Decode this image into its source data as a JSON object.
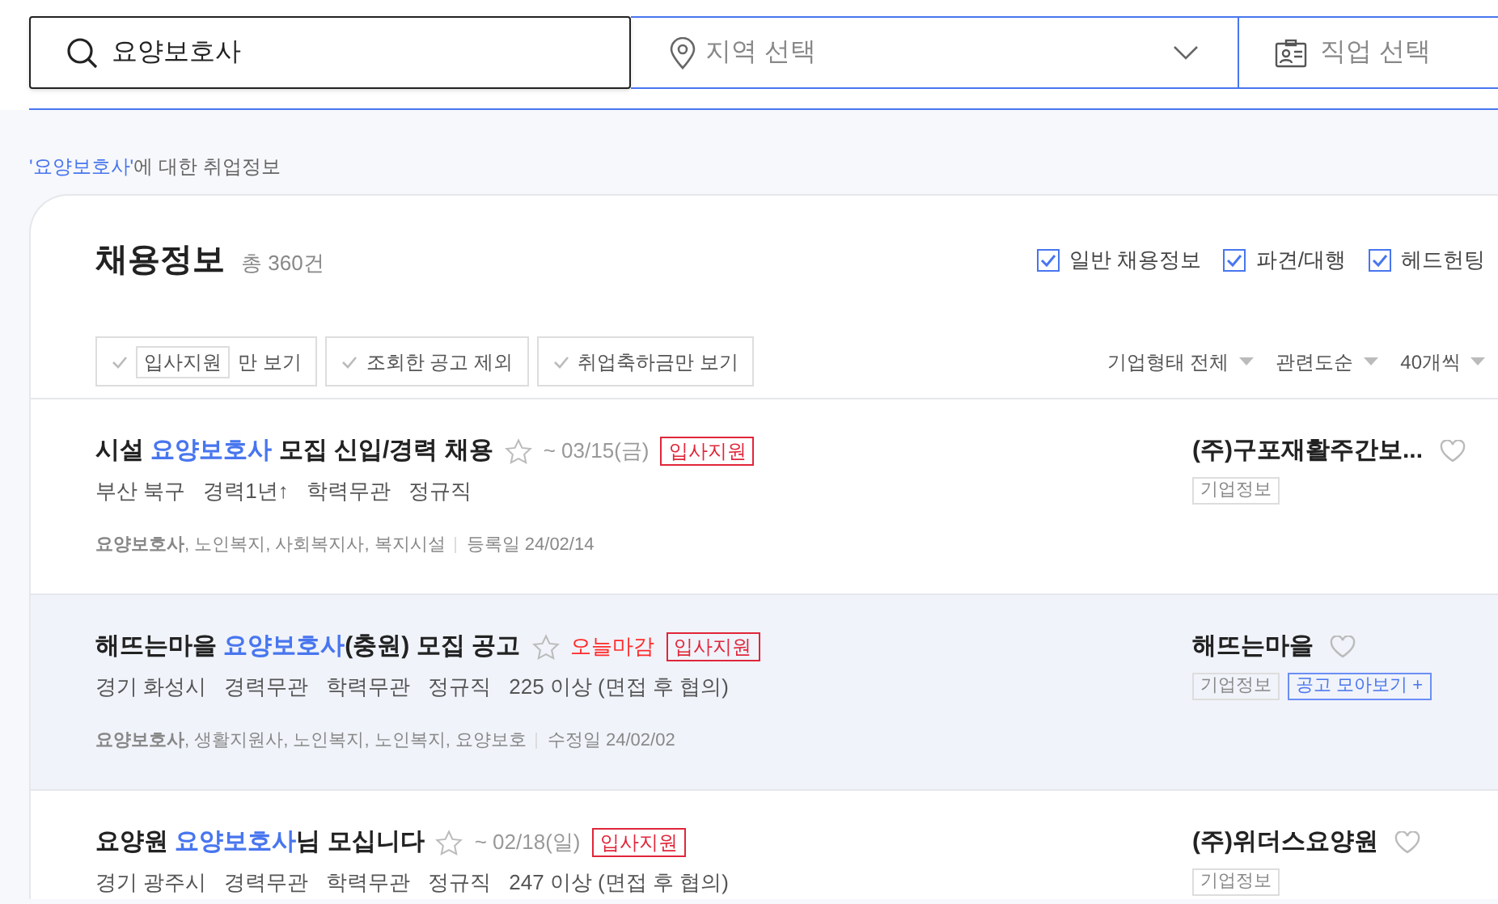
{
  "search": {
    "value": "요양보호사"
  },
  "region": {
    "placeholder": "지역 선택"
  },
  "job": {
    "placeholder": "직업 선택"
  },
  "result_caption": {
    "keyword": "'요양보호사'",
    "text": "에 대한 취업정보"
  },
  "header": {
    "title": "채용정보",
    "count": "총 360건"
  },
  "categories": [
    {
      "label": "일반 채용정보",
      "checked": true
    },
    {
      "label": "파견/대행",
      "checked": true
    },
    {
      "label": "헤드헌팅",
      "checked": true
    }
  ],
  "filters": [
    {
      "badge": "입사지원",
      "label": "만 보기",
      "checked": false
    },
    {
      "label": "조회한 공고 제외",
      "checked": false
    },
    {
      "label": "취업축하금만 보기",
      "checked": false
    }
  ],
  "sorts": [
    "기업형태 전체",
    "관련도순",
    "40개씩"
  ],
  "jobs": [
    {
      "title": {
        "prefix": "시설 ",
        "keyword": "요양보호사",
        "suffix": " 모집 신입/경력 채용"
      },
      "deadline": "~ 03/15(금)",
      "urgent": false,
      "apply": "입사지원",
      "info": [
        "부산 북구",
        "경력1년↑",
        "학력무관",
        "정규직"
      ],
      "keywords": "**요양보호사**, 노인복지, 사회복지사, 복지시설",
      "date": "등록일 24/02/14",
      "company": "(주)구포재활주간보...",
      "tags": [
        {
          "kind": "info",
          "label": "기업정보"
        }
      ],
      "hovered": false
    },
    {
      "title": {
        "prefix": "해뜨는마을 ",
        "keyword": "요양보호사",
        "suffix": "(충원) 모집 공고"
      },
      "deadline": "오늘마감",
      "urgent": true,
      "apply": "입사지원",
      "info": [
        "경기 화성시",
        "경력무관",
        "학력무관",
        "정규직",
        "225 이상 (면접 후 협의)"
      ],
      "keywords": "**요양보호사**, 생활지원사, 노인복지, 노인복지, 요양보호",
      "date": "수정일 24/02/02",
      "company": "해뜨는마을",
      "tags": [
        {
          "kind": "info",
          "label": "기업정보"
        },
        {
          "kind": "collect",
          "label": "공고 모아보기 +"
        }
      ],
      "hovered": true
    },
    {
      "title": {
        "prefix": "요양원 ",
        "keyword": "요양보호사",
        "suffix": "님 모십니다"
      },
      "deadline": "~ 02/18(일)",
      "urgent": false,
      "apply": "입사지원",
      "info": [
        "경기 광주시",
        "경력무관",
        "학력무관",
        "정규직",
        "247 이상 (면접 후 협의)"
      ],
      "company": "(주)위더스요양원",
      "tags": [
        {
          "kind": "info",
          "label": "기업정보"
        }
      ],
      "hovered": false
    }
  ]
}
